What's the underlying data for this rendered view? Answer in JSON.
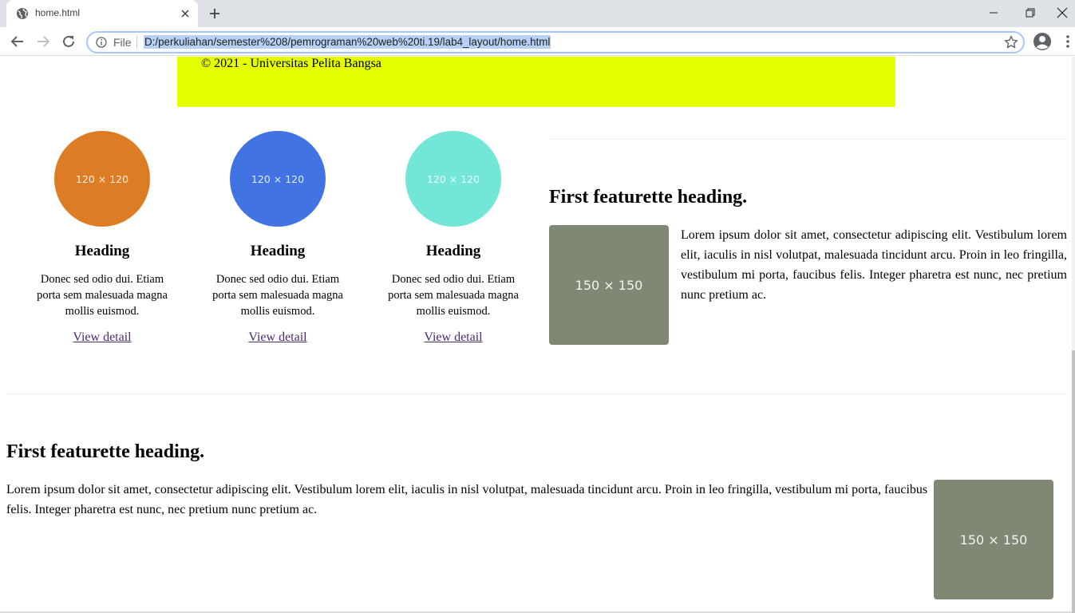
{
  "browser": {
    "tab_title": "home.html",
    "file_label": "File",
    "url": "D:/perkuliahan/semester%208/pemrograman%20web%20ti.19/lab4_layout/home.html"
  },
  "footer": {
    "text": "© 2021 - Universitas Pelita Bangsa"
  },
  "columns": [
    {
      "placeholder": "120 × 120",
      "color": "#dc7d25",
      "heading": "Heading",
      "text": "Donec sed odio dui. Etiam porta sem malesuada magna mollis euismod.",
      "link": "View detail"
    },
    {
      "placeholder": "120 × 120",
      "color": "#4173e3",
      "heading": "Heading",
      "text": "Donec sed odio dui. Etiam porta sem malesuada magna mollis euismod.",
      "link": "View detail"
    },
    {
      "placeholder": "120 × 120",
      "color": "#73e6d7",
      "heading": "Heading",
      "text": "Donec sed odio dui. Etiam porta sem malesuada magna mollis euismod.",
      "link": "View detail"
    }
  ],
  "featurette_right": {
    "heading": "First featurette heading.",
    "placeholder": "150 × 150",
    "text": "Lorem ipsum dolor sit amet, consectetur adipiscing elit. Vestibulum lorem elit, iaculis in nisl volutpat, malesuada tincidunt arcu. Proin in leo fringilla, vestibulum mi porta, faucibus felis. Integer pharetra est nunc, nec pretium nunc pretium ac."
  },
  "featurette_bottom": {
    "heading": "First featurette heading.",
    "placeholder": "150 × 150",
    "text": "Lorem ipsum dolor sit amet, consectetur adipiscing elit. Vestibulum lorem elit, iaculis in nisl volutpat, malesuada tincidunt arcu. Proin in leo fringilla, vestibulum mi porta, faucibus felis. Integer pharetra est nunc, nec pretium nunc pretium ac."
  },
  "colors": {
    "footer_bg": "#e5ff00",
    "placeholder_bg": "#7e8872",
    "link": "#4b2a6e"
  }
}
